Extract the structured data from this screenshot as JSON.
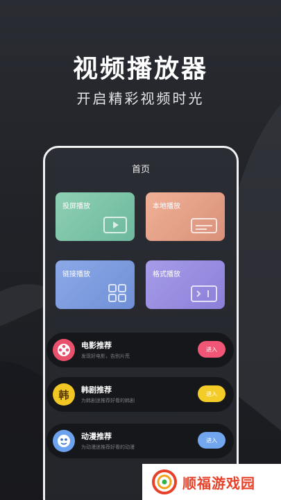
{
  "promo": {
    "title": "视频播放器",
    "subtitle": "开启精彩视频时光"
  },
  "phone": {
    "page_title": "首页",
    "tiles": [
      {
        "label": "投屏播放",
        "icon": "screen-play-icon",
        "color": "#7fc6aa"
      },
      {
        "label": "本地播放",
        "icon": "local-folder-icon",
        "color": "#e8a48b"
      },
      {
        "label": "链接播放",
        "icon": "link-icon",
        "color": "#7e9ee0"
      },
      {
        "label": "格式播放",
        "icon": "format-icon",
        "color": "#9a8fe2"
      }
    ],
    "recommendations": [
      {
        "title": "电影推荐",
        "desc": "发现好电影，告别片荒",
        "button": "进入",
        "icon": "film-reel-icon",
        "accent": "#f25677"
      },
      {
        "title": "韩剧推荐",
        "desc": "为韩剧迷推荐好看的韩剧",
        "button": "进入",
        "icon": "korean-drama-icon",
        "badge": "韩",
        "accent": "#f4cc27"
      },
      {
        "title": "动漫推荐",
        "desc": "为动漫迷推荐好看的动漫",
        "button": "进入",
        "icon": "anime-icon",
        "accent": "#72a6ee"
      }
    ]
  },
  "watermark": {
    "text": "顺福游戏园",
    "icon": "logo-icon"
  }
}
